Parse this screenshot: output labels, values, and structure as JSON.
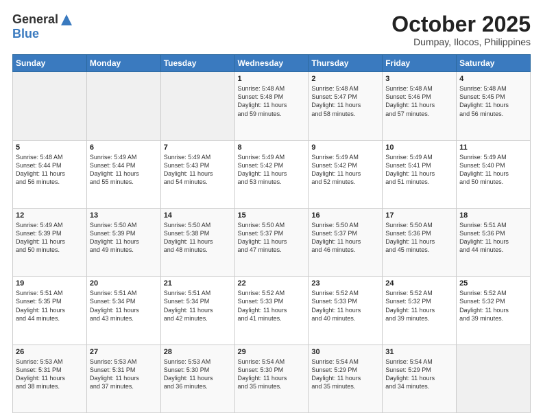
{
  "header": {
    "logo_general": "General",
    "logo_blue": "Blue",
    "month_title": "October 2025",
    "subtitle": "Dumpay, Ilocos, Philippines"
  },
  "weekdays": [
    "Sunday",
    "Monday",
    "Tuesday",
    "Wednesday",
    "Thursday",
    "Friday",
    "Saturday"
  ],
  "weeks": [
    [
      {
        "day": "",
        "info": ""
      },
      {
        "day": "",
        "info": ""
      },
      {
        "day": "",
        "info": ""
      },
      {
        "day": "1",
        "info": "Sunrise: 5:48 AM\nSunset: 5:48 PM\nDaylight: 11 hours\nand 59 minutes."
      },
      {
        "day": "2",
        "info": "Sunrise: 5:48 AM\nSunset: 5:47 PM\nDaylight: 11 hours\nand 58 minutes."
      },
      {
        "day": "3",
        "info": "Sunrise: 5:48 AM\nSunset: 5:46 PM\nDaylight: 11 hours\nand 57 minutes."
      },
      {
        "day": "4",
        "info": "Sunrise: 5:48 AM\nSunset: 5:45 PM\nDaylight: 11 hours\nand 56 minutes."
      }
    ],
    [
      {
        "day": "5",
        "info": "Sunrise: 5:48 AM\nSunset: 5:44 PM\nDaylight: 11 hours\nand 56 minutes."
      },
      {
        "day": "6",
        "info": "Sunrise: 5:49 AM\nSunset: 5:44 PM\nDaylight: 11 hours\nand 55 minutes."
      },
      {
        "day": "7",
        "info": "Sunrise: 5:49 AM\nSunset: 5:43 PM\nDaylight: 11 hours\nand 54 minutes."
      },
      {
        "day": "8",
        "info": "Sunrise: 5:49 AM\nSunset: 5:42 PM\nDaylight: 11 hours\nand 53 minutes."
      },
      {
        "day": "9",
        "info": "Sunrise: 5:49 AM\nSunset: 5:42 PM\nDaylight: 11 hours\nand 52 minutes."
      },
      {
        "day": "10",
        "info": "Sunrise: 5:49 AM\nSunset: 5:41 PM\nDaylight: 11 hours\nand 51 minutes."
      },
      {
        "day": "11",
        "info": "Sunrise: 5:49 AM\nSunset: 5:40 PM\nDaylight: 11 hours\nand 50 minutes."
      }
    ],
    [
      {
        "day": "12",
        "info": "Sunrise: 5:49 AM\nSunset: 5:39 PM\nDaylight: 11 hours\nand 50 minutes."
      },
      {
        "day": "13",
        "info": "Sunrise: 5:50 AM\nSunset: 5:39 PM\nDaylight: 11 hours\nand 49 minutes."
      },
      {
        "day": "14",
        "info": "Sunrise: 5:50 AM\nSunset: 5:38 PM\nDaylight: 11 hours\nand 48 minutes."
      },
      {
        "day": "15",
        "info": "Sunrise: 5:50 AM\nSunset: 5:37 PM\nDaylight: 11 hours\nand 47 minutes."
      },
      {
        "day": "16",
        "info": "Sunrise: 5:50 AM\nSunset: 5:37 PM\nDaylight: 11 hours\nand 46 minutes."
      },
      {
        "day": "17",
        "info": "Sunrise: 5:50 AM\nSunset: 5:36 PM\nDaylight: 11 hours\nand 45 minutes."
      },
      {
        "day": "18",
        "info": "Sunrise: 5:51 AM\nSunset: 5:36 PM\nDaylight: 11 hours\nand 44 minutes."
      }
    ],
    [
      {
        "day": "19",
        "info": "Sunrise: 5:51 AM\nSunset: 5:35 PM\nDaylight: 11 hours\nand 44 minutes."
      },
      {
        "day": "20",
        "info": "Sunrise: 5:51 AM\nSunset: 5:34 PM\nDaylight: 11 hours\nand 43 minutes."
      },
      {
        "day": "21",
        "info": "Sunrise: 5:51 AM\nSunset: 5:34 PM\nDaylight: 11 hours\nand 42 minutes."
      },
      {
        "day": "22",
        "info": "Sunrise: 5:52 AM\nSunset: 5:33 PM\nDaylight: 11 hours\nand 41 minutes."
      },
      {
        "day": "23",
        "info": "Sunrise: 5:52 AM\nSunset: 5:33 PM\nDaylight: 11 hours\nand 40 minutes."
      },
      {
        "day": "24",
        "info": "Sunrise: 5:52 AM\nSunset: 5:32 PM\nDaylight: 11 hours\nand 39 minutes."
      },
      {
        "day": "25",
        "info": "Sunrise: 5:52 AM\nSunset: 5:32 PM\nDaylight: 11 hours\nand 39 minutes."
      }
    ],
    [
      {
        "day": "26",
        "info": "Sunrise: 5:53 AM\nSunset: 5:31 PM\nDaylight: 11 hours\nand 38 minutes."
      },
      {
        "day": "27",
        "info": "Sunrise: 5:53 AM\nSunset: 5:31 PM\nDaylight: 11 hours\nand 37 minutes."
      },
      {
        "day": "28",
        "info": "Sunrise: 5:53 AM\nSunset: 5:30 PM\nDaylight: 11 hours\nand 36 minutes."
      },
      {
        "day": "29",
        "info": "Sunrise: 5:54 AM\nSunset: 5:30 PM\nDaylight: 11 hours\nand 35 minutes."
      },
      {
        "day": "30",
        "info": "Sunrise: 5:54 AM\nSunset: 5:29 PM\nDaylight: 11 hours\nand 35 minutes."
      },
      {
        "day": "31",
        "info": "Sunrise: 5:54 AM\nSunset: 5:29 PM\nDaylight: 11 hours\nand 34 minutes."
      },
      {
        "day": "",
        "info": ""
      }
    ]
  ]
}
